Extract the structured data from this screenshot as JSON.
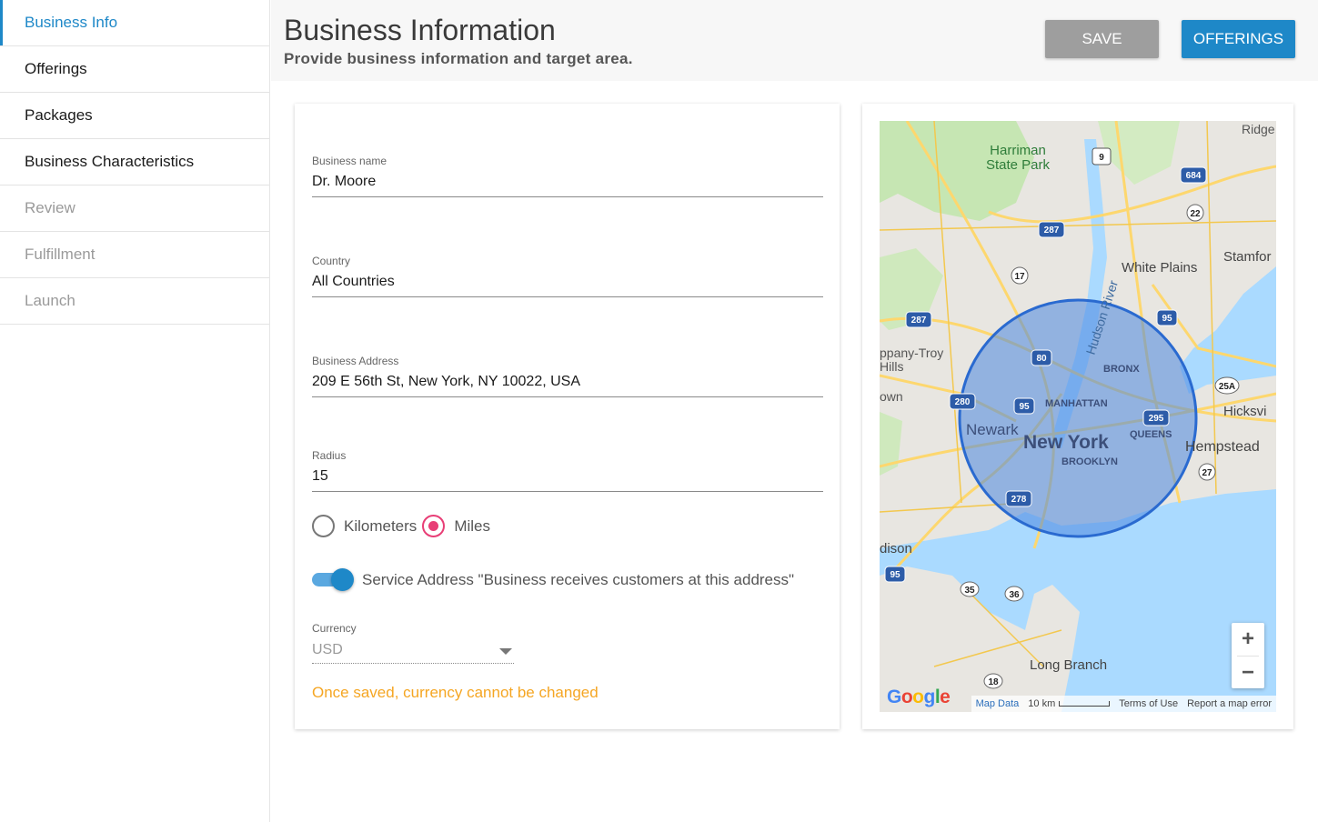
{
  "sidebar": {
    "items": [
      {
        "label": "Business Info"
      },
      {
        "label": "Offerings"
      },
      {
        "label": "Packages"
      },
      {
        "label": "Business Characteristics"
      },
      {
        "label": "Review"
      },
      {
        "label": "Fulfillment"
      },
      {
        "label": "Launch"
      }
    ]
  },
  "header": {
    "title": "Business Information",
    "subtitle": "Provide business information and target area.",
    "save_label": "SAVE",
    "offerings_label": "OFFERINGS"
  },
  "form": {
    "business_name": {
      "label": "Business name",
      "value": "Dr. Moore"
    },
    "country": {
      "label": "Country",
      "value": "All Countries"
    },
    "address": {
      "label": "Business Address",
      "value": "209 E 56th St, New York, NY 10022, USA"
    },
    "radius": {
      "label": "Radius",
      "value": "15"
    },
    "units": {
      "kilometers": "Kilometers",
      "miles": "Miles",
      "selected": "Miles"
    },
    "service_address": {
      "label": "Service Address \"Business receives customers at this address\"",
      "enabled": true
    },
    "currency": {
      "label": "Currency",
      "value": "USD",
      "warning": "Once saved, currency cannot be changed"
    }
  },
  "map": {
    "labels": {
      "harriman1": "Harriman",
      "harriman2": "State Park",
      "ridge": "Ridge",
      "white_plains": "White Plains",
      "stamford": "Stamfor",
      "hudson": "Hudson River",
      "troy1": "ppany-Troy",
      "troy2": "Hills",
      "town": "own",
      "bronx": "BRONX",
      "manhattan": "MANHATTAN",
      "queens": "QUEENS",
      "brooklyn": "BROOKLYN",
      "newark": "Newark",
      "new_york": "New York",
      "hicksville": "Hicksvi",
      "hempstead": "Hempstead",
      "edison": "dison",
      "long_branch": "Long Branch"
    },
    "shields": {
      "s9": "9",
      "s684": "684",
      "s22": "22",
      "s287a": "287",
      "s17": "17",
      "s287b": "287",
      "s95a": "95",
      "s80": "80",
      "s280": "280",
      "s95b": "95",
      "s295": "295",
      "s25a": "25A",
      "s27": "27",
      "s278": "278",
      "s95c": "95",
      "s35": "35",
      "s36": "36",
      "s18": "18"
    },
    "zoom_in": "+",
    "zoom_out": "−",
    "footer": {
      "google": "Google",
      "map_data": "Map Data",
      "scale": "10 km",
      "terms": "Terms of Use",
      "report": "Report a map error"
    },
    "colors": {
      "water": "#aadaff",
      "land": "#e8e6e1",
      "park": "#c6e6b3",
      "highway": "#fdd76e",
      "circle_fill": "#4a86e0",
      "circle_stroke": "#2a6ad0"
    }
  }
}
